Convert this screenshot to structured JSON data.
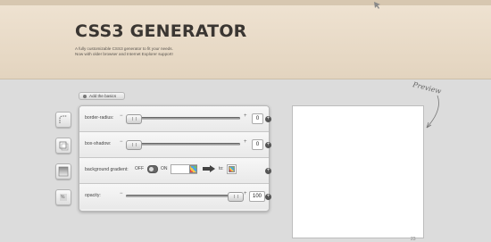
{
  "header": {
    "title": "CSS3 GENERATOR",
    "desc_line1": "A fully customizable CSS3 generator to fit your needs.",
    "desc_line2": "Now with older browser and Internet Explorer support!"
  },
  "basics_button": {
    "label": "Add the basics"
  },
  "controls": {
    "border_radius": {
      "label": "border-radius:",
      "minus": "−",
      "plus": "+",
      "value": "0",
      "level": 0
    },
    "box_shadow": {
      "label": "box-shadow:",
      "minus": "−",
      "plus": "+",
      "value": "0",
      "level": 0
    },
    "background_gradient": {
      "label": "background gradient:",
      "off": "OFF",
      "on": "ON",
      "to": "to:"
    },
    "opacity": {
      "label": "opacity:",
      "minus": "−",
      "plus": "+",
      "value": "100",
      "level": 100
    }
  },
  "add_icon": "+",
  "preview": {
    "label": "Preview",
    "counter": "23"
  },
  "colors": {
    "header_bg": "#e9dcc8",
    "page_bg": "#dcdcdc",
    "accent": "#555555"
  },
  "icons": [
    "cursor-icon",
    "border-radius-icon",
    "box-shadow-icon",
    "gradient-icon",
    "opacity-icon",
    "add-icon",
    "arrow-icon",
    "color-swatch-icon"
  ]
}
